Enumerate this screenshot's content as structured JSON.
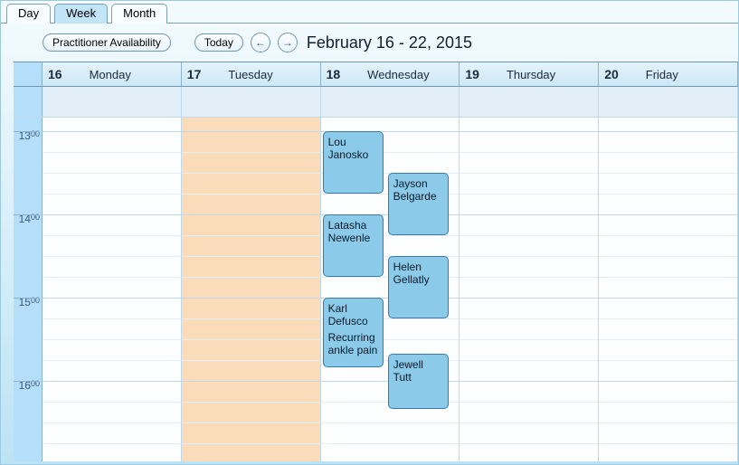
{
  "tabs": {
    "day": "Day",
    "week": "Week",
    "month": "Month",
    "active": "week"
  },
  "toolbar": {
    "avail": "Practitioner Availability",
    "today": "Today",
    "range": "February 16 - 22, 2015"
  },
  "days": [
    {
      "num": "16",
      "name": "Monday"
    },
    {
      "num": "17",
      "name": "Tuesday"
    },
    {
      "num": "18",
      "name": "Wednesday"
    },
    {
      "num": "19",
      "name": "Thursday"
    },
    {
      "num": "20",
      "name": "Friday"
    }
  ],
  "hours": [
    "13",
    "14",
    "15",
    "16"
  ],
  "hourSuffix": "00",
  "appointments": [
    {
      "day": 2,
      "col": 0,
      "start": 13.0,
      "end": 13.75,
      "title": "Lou Janosko",
      "note": ""
    },
    {
      "day": 2,
      "col": 0,
      "start": 14.0,
      "end": 14.75,
      "title": "Latasha Newenle",
      "note": ""
    },
    {
      "day": 2,
      "col": 0,
      "start": 15.0,
      "end": 15.833,
      "title": "Karl Defusco",
      "note": "Recurring ankle pain"
    },
    {
      "day": 2,
      "col": 1,
      "start": 13.5,
      "end": 14.25,
      "title": "Jayson Belgarde",
      "note": ""
    },
    {
      "day": 2,
      "col": 1,
      "start": 14.5,
      "end": 15.25,
      "title": "Helen Gellatly",
      "note": ""
    },
    {
      "day": 2,
      "col": 1,
      "start": 15.667,
      "end": 16.333,
      "title": "Jewell Tutt",
      "note": ""
    }
  ],
  "busyDay": 1,
  "gridStartHour": 12.833,
  "hourHeight": 92,
  "apptColWidth": 67
}
